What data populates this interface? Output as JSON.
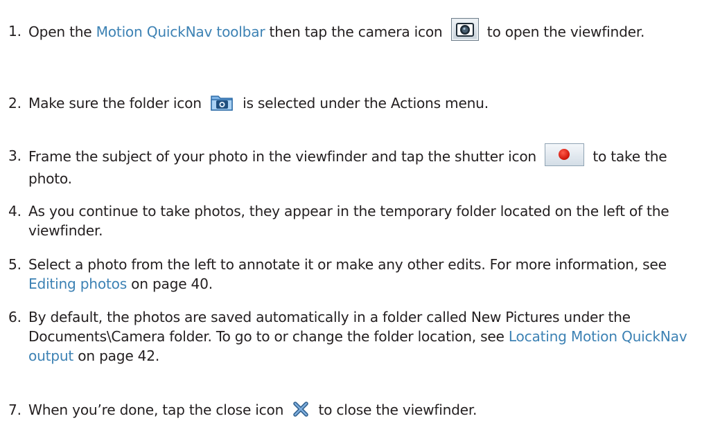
{
  "steps": [
    {
      "num": "1.",
      "before": "Open the ",
      "link": "Motion QuickNav toolbar",
      "mid": " then tap the camera icon ",
      "icon": "camera-icon",
      "after": " to open the viewfinder."
    },
    {
      "num": "2.",
      "before": "Make sure the folder icon ",
      "icon": "folder-camera-icon",
      "after": " is selected under the Actions menu."
    },
    {
      "num": "3.",
      "before": "Frame the subject of your photo in the viewfinder and tap the shutter icon ",
      "icon": "shutter-record-icon",
      "after": " to take the photo."
    },
    {
      "num": "4.",
      "text": "As you continue to take photos, they appear in the temporary folder located on the left of the viewfinder."
    },
    {
      "num": "5.",
      "before": "Select a photo from the left to annotate it or make any other edits. For more information, see ",
      "link": "Editing photos",
      "after": " on page 40."
    },
    {
      "num": "6.",
      "before": "By default, the photos are saved automatically in a folder called New Pictures under the Documents\\Camera folder. To go to or change the folder location, see ",
      "link": "Locating Motion QuickNav output",
      "after": " on page 42."
    },
    {
      "num": "7.",
      "before": "When you’re done, tap the close icon ",
      "icon": "close-icon",
      "after": " to close the viewfinder."
    }
  ],
  "colors": {
    "text": "#231f20",
    "link": "#3d82b4",
    "record_red": "#d1180c"
  }
}
